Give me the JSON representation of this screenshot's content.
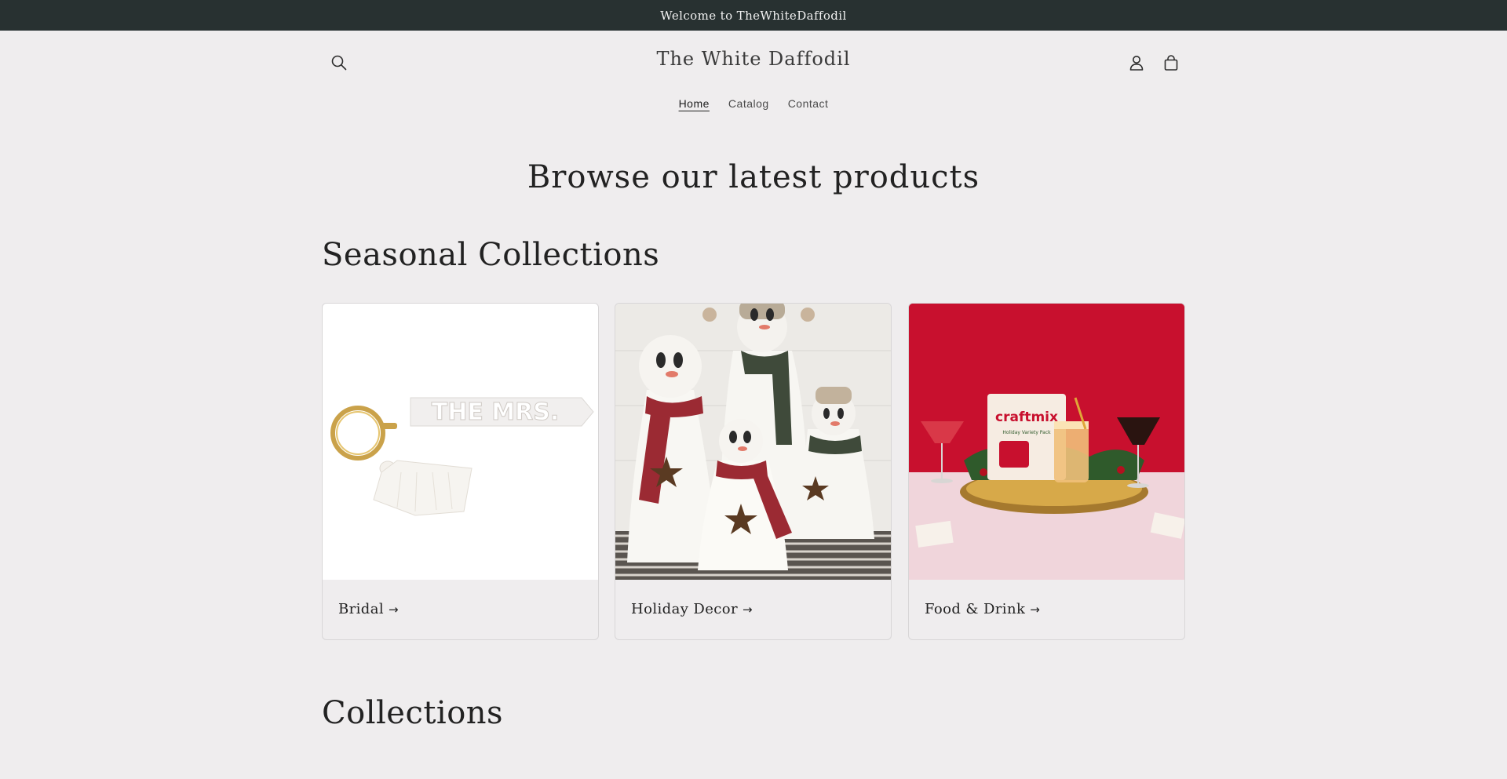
{
  "announcement": {
    "text": "Welcome to TheWhiteDaffodil"
  },
  "header": {
    "brand": "The White Daffodil",
    "icons": {
      "search": "search-icon",
      "account": "user-icon",
      "cart": "cart-icon"
    },
    "nav": [
      {
        "label": "Home",
        "active": true
      },
      {
        "label": "Catalog",
        "active": false
      },
      {
        "label": "Contact",
        "active": false
      }
    ]
  },
  "main": {
    "page_heading": "Browse our latest products",
    "seasonal": {
      "heading": "Seasonal Collections",
      "cards": [
        {
          "label": "Bridal",
          "arrow": "→",
          "image_text": "THE MRS."
        },
        {
          "label": "Holiday Decor",
          "arrow": "→"
        },
        {
          "label": "Food & Drink",
          "arrow": "→",
          "image_text": "craftmix",
          "image_subtext": "Holiday Variety Pack"
        }
      ]
    },
    "collections": {
      "heading": "Collections"
    }
  },
  "colors": {
    "announcement_bg": "#283131",
    "page_bg": "#efedee",
    "food_card_bg": "#c8102e"
  }
}
